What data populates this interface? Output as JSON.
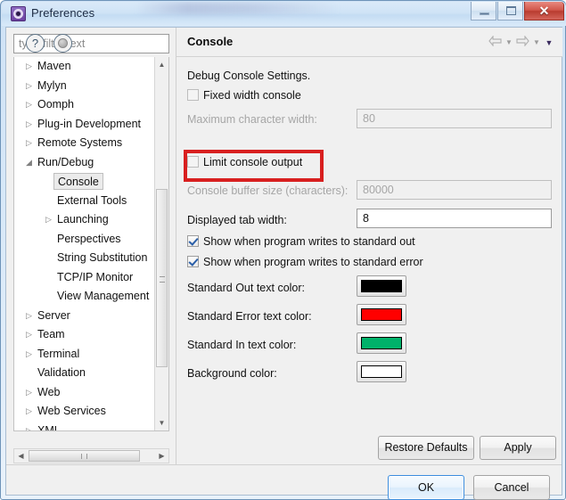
{
  "window": {
    "title": "Preferences",
    "icon": "preferences-gear-icon",
    "controls": {
      "minimize": "minimize-icon",
      "maximize": "restore-icon",
      "close": "✕"
    }
  },
  "sidebar": {
    "filter": {
      "placeholder": "type filter text",
      "value": ""
    },
    "items": [
      {
        "label": "Maven",
        "indent": 0,
        "twisty": "collapsed",
        "selected": false
      },
      {
        "label": "Mylyn",
        "indent": 0,
        "twisty": "collapsed",
        "selected": false
      },
      {
        "label": "Oomph",
        "indent": 0,
        "twisty": "collapsed",
        "selected": false
      },
      {
        "label": "Plug-in Development",
        "indent": 0,
        "twisty": "collapsed",
        "selected": false
      },
      {
        "label": "Remote Systems",
        "indent": 0,
        "twisty": "collapsed",
        "selected": false
      },
      {
        "label": "Run/Debug",
        "indent": 0,
        "twisty": "expanded",
        "selected": false
      },
      {
        "label": "Console",
        "indent": 1,
        "twisty": "none",
        "selected": true
      },
      {
        "label": "External Tools",
        "indent": 1,
        "twisty": "none",
        "selected": false
      },
      {
        "label": "Launching",
        "indent": 1,
        "twisty": "collapsed",
        "selected": false
      },
      {
        "label": "Perspectives",
        "indent": 1,
        "twisty": "none",
        "selected": false
      },
      {
        "label": "String Substitution",
        "indent": 1,
        "twisty": "none",
        "selected": false
      },
      {
        "label": "TCP/IP Monitor",
        "indent": 1,
        "twisty": "none",
        "selected": false
      },
      {
        "label": "View Management",
        "indent": 1,
        "twisty": "none",
        "selected": false
      },
      {
        "label": "Server",
        "indent": 0,
        "twisty": "collapsed",
        "selected": false
      },
      {
        "label": "Team",
        "indent": 0,
        "twisty": "collapsed",
        "selected": false
      },
      {
        "label": "Terminal",
        "indent": 0,
        "twisty": "collapsed",
        "selected": false
      },
      {
        "label": "Validation",
        "indent": 0,
        "twisty": "none",
        "selected": false
      },
      {
        "label": "Web",
        "indent": 0,
        "twisty": "collapsed",
        "selected": false
      },
      {
        "label": "Web Services",
        "indent": 0,
        "twisty": "collapsed",
        "selected": false
      },
      {
        "label": "XML",
        "indent": 0,
        "twisty": "collapsed",
        "selected": false
      }
    ]
  },
  "page": {
    "title": "Console",
    "nav": {
      "back": "back-arrow-icon",
      "back_menu": "chevron-down-icon",
      "forward": "forward-arrow-icon",
      "forward_menu": "chevron-down-icon",
      "view_menu": "chevron-down-icon"
    },
    "section_label": "Debug Console Settings.",
    "fixed_width": {
      "label": "Fixed width console",
      "checked": false,
      "enabled": true
    },
    "max_char_width": {
      "label": "Maximum character width:",
      "value": "80",
      "enabled": false
    },
    "limit_output": {
      "label": "Limit console output",
      "checked": false,
      "enabled": true,
      "highlighted": true
    },
    "buffer_size": {
      "label": "Console buffer size (characters):",
      "value": "80000",
      "enabled": false
    },
    "tab_width": {
      "label": "Displayed tab width:",
      "value": "8",
      "enabled": true
    },
    "show_stdout": {
      "label": "Show when program writes to standard out",
      "checked": true
    },
    "show_stderr": {
      "label": "Show when program writes to standard error",
      "checked": true
    },
    "colors": [
      {
        "label": "Standard Out text color:",
        "color": "#000000"
      },
      {
        "label": "Standard Error text color:",
        "color": "#ff0000"
      },
      {
        "label": "Standard In text color:",
        "color": "#00b26a"
      },
      {
        "label": "Background color:",
        "color": "#ffffff"
      }
    ],
    "restore_defaults": "Restore Defaults",
    "apply": "Apply"
  },
  "footer": {
    "help_icon": "?",
    "info_icon": "info-icon",
    "ok": "OK",
    "cancel": "Cancel"
  },
  "accent": {
    "highlight": "#d81f1f",
    "focus_border": "#3c8dde"
  }
}
